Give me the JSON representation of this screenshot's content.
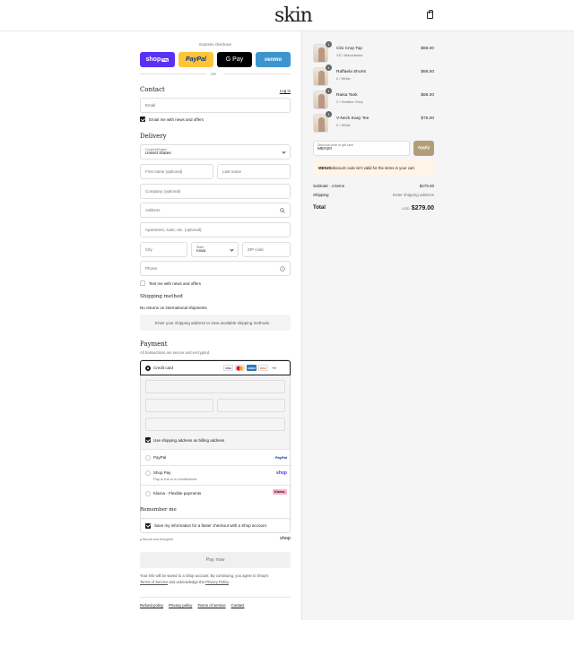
{
  "header": {
    "logo": "skin"
  },
  "express": {
    "label": "Express checkout",
    "or": "OR",
    "shop": "shop",
    "shop_badge": "Pay",
    "paypal": "PayPal",
    "gpay": "G Pay",
    "venmo": "venmo"
  },
  "contact": {
    "title": "Contact",
    "login": "Log in",
    "email_placeholder": "Email",
    "news_label": "Email me with news and offers"
  },
  "delivery": {
    "title": "Delivery",
    "country_label": "Country/Region",
    "country": "United States",
    "first_name": "First name (optional)",
    "last_name": "Last name",
    "company": "Company (optional)",
    "address": "Address",
    "apartment": "Apartment, suite, etc. (optional)",
    "city": "City",
    "state_label": "State",
    "state": "Iowa",
    "zip": "ZIP code",
    "phone": "Phone",
    "text_label": "Text me with news and offers"
  },
  "shipping": {
    "title": "Shipping method",
    "note": "No returns on international shipments",
    "placeholder": "Enter your shipping address to view available shipping methods."
  },
  "payment": {
    "title": "Payment",
    "subtitle": "All transactions are secure and encrypted.",
    "credit": "Credit card",
    "card_more": "+9",
    "billing": "Use shipping address as billing address",
    "paypal": "PayPal",
    "paypal_logo": "PayPal",
    "shoppay": "Shop Pay",
    "shoppay_sub": "Pay in full or in installments",
    "shoppay_logo": "shop",
    "klarna": "Klarna - Flexible payments",
    "klarna_logo": "Klarna.",
    "cards": [
      "VISA",
      "MC",
      "AMEX",
      "DISC"
    ]
  },
  "remember": {
    "title": "Remember me",
    "save": "Save my information for a faster checkout with a Shop account",
    "secure": "Secure and encrypted",
    "shop": "shop"
  },
  "paynow": "Pay now",
  "legal": {
    "line1": "Your info will be saved to a Shop account. By continuing, you agree to Shop's",
    "terms": "Terms of Service",
    "mid": " and acknowledge the ",
    "privacy": "Privacy Policy",
    "end": "."
  },
  "footer": [
    "Refund policy",
    "Privacy policy",
    "Terms of service",
    "Contact"
  ],
  "cart": {
    "items": [
      {
        "qty": "1",
        "name": "Clio Crop Top",
        "variant": "XS / Macadamia",
        "price": "$68.00"
      },
      {
        "qty": "1",
        "name": "Raffaela Shorts",
        "variant": "0 / White",
        "price": "$68.00"
      },
      {
        "qty": "1",
        "name": "Raisa Tank",
        "variant": "2 / Heather Grey",
        "price": "$68.00"
      },
      {
        "qty": "1",
        "name": "V-Neck Easy Tee",
        "variant": "0 / White",
        "price": "$75.00"
      }
    ],
    "discount_label": "Discount code or gift card",
    "discount_value": "MEN20",
    "apply": "Apply",
    "warn_code": "MEN20",
    "warn_text": " discount code isn't valid for the items in your cart",
    "subtotal_label": "Subtotal · 4 items",
    "subtotal": "$279.00",
    "shipping_label": "Shipping",
    "shipping_value": "Enter shipping address",
    "total_label": "Total",
    "currency": "USD",
    "total": "$279.00"
  }
}
